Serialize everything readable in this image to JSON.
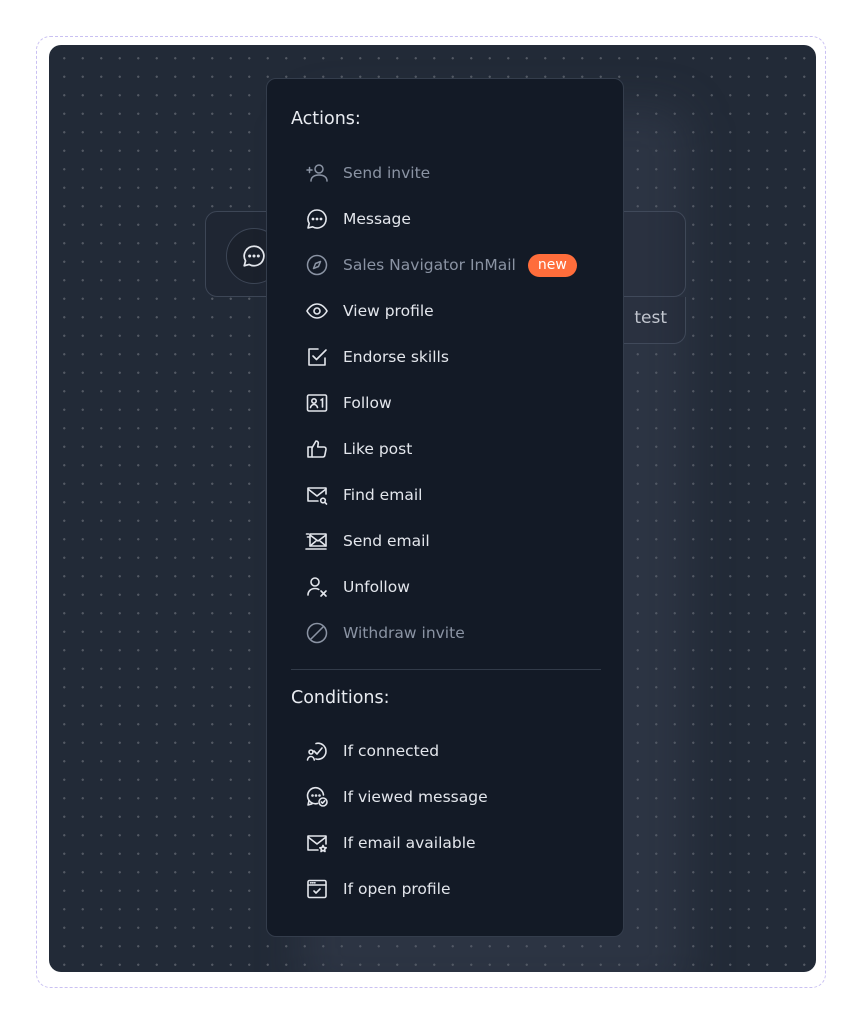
{
  "node": {
    "sub_label": "test"
  },
  "menu": {
    "actions_title": "Actions:",
    "conditions_title": "Conditions:",
    "actions": [
      {
        "label": "Send invite",
        "icon": "add-user-icon",
        "disabled": true
      },
      {
        "label": "Message",
        "icon": "message-icon",
        "disabled": false
      },
      {
        "label": "Sales Navigator InMail",
        "icon": "compass-icon",
        "disabled": true,
        "badge": "new"
      },
      {
        "label": "View profile",
        "icon": "eye-icon",
        "disabled": false
      },
      {
        "label": "Endorse skills",
        "icon": "checkbox-icon",
        "disabled": false
      },
      {
        "label": "Follow",
        "icon": "profile-card-icon",
        "disabled": false
      },
      {
        "label": "Like post",
        "icon": "thumbs-up-icon",
        "disabled": false
      },
      {
        "label": "Find email",
        "icon": "mail-search-icon",
        "disabled": false
      },
      {
        "label": "Send email",
        "icon": "send-mail-icon",
        "disabled": false
      },
      {
        "label": "Unfollow",
        "icon": "user-remove-icon",
        "disabled": false
      },
      {
        "label": "Withdraw invite",
        "icon": "block-icon",
        "disabled": true
      }
    ],
    "conditions": [
      {
        "label": "If connected",
        "icon": "connected-icon"
      },
      {
        "label": "If viewed message",
        "icon": "message-check-icon"
      },
      {
        "label": "If email available",
        "icon": "mail-star-icon"
      },
      {
        "label": "If open profile",
        "icon": "browser-check-icon"
      }
    ]
  },
  "colors": {
    "badge": "#ff6d3b",
    "menu_bg": "#131a26",
    "canvas_bg": "#222a37"
  }
}
